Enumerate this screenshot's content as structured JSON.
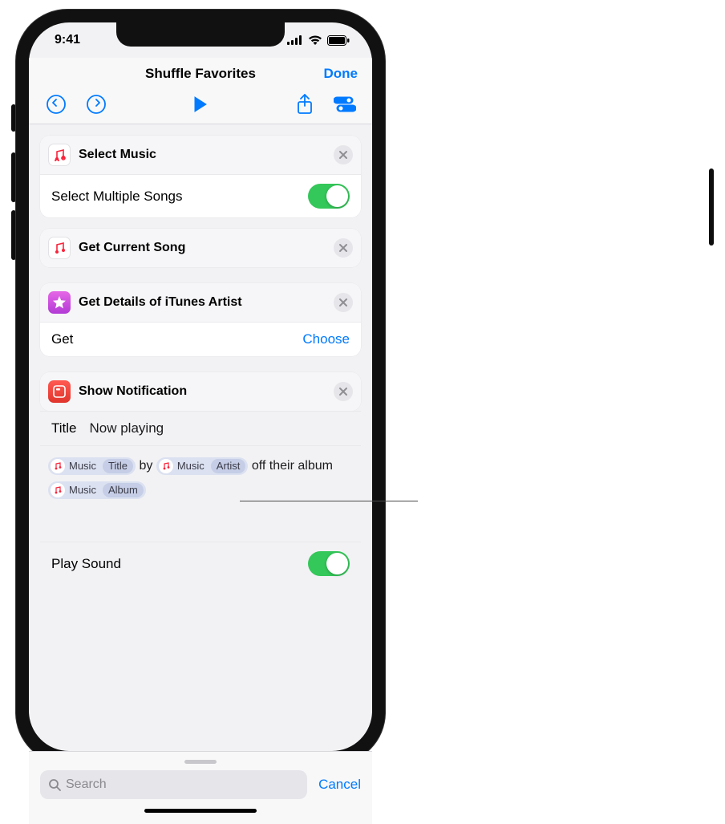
{
  "status": {
    "time": "9:41"
  },
  "nav": {
    "title": "Shuffle Favorites",
    "done": "Done"
  },
  "actions": {
    "select_music": {
      "title": "Select Music",
      "row_label": "Select Multiple Songs"
    },
    "get_current_song": {
      "title": "Get Current Song"
    },
    "get_details": {
      "title": "Get Details of iTunes Artist",
      "row_label": "Get",
      "row_action": "Choose"
    },
    "show_notification": {
      "title": "Show Notification",
      "title_field_label": "Title",
      "title_field_value": "Now playing",
      "body_text_1": " by ",
      "body_text_2": " off their album ",
      "token_main": "Music",
      "token_detail_title": "Title",
      "token_detail_artist": "Artist",
      "token_detail_album": "Album",
      "play_sound_label": "Play Sound"
    }
  },
  "search": {
    "placeholder": "Search",
    "cancel": "Cancel"
  }
}
